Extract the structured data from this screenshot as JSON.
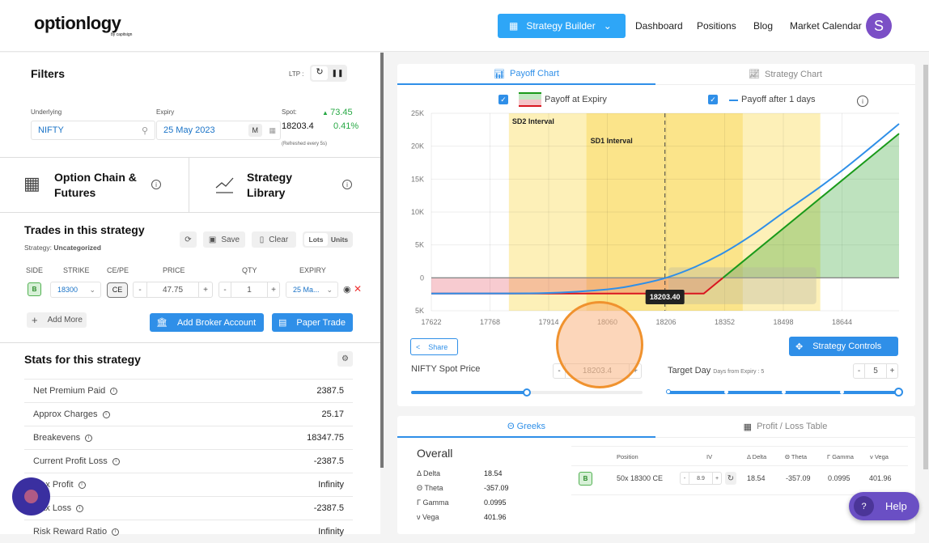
{
  "header": {
    "logo": "optionlogy",
    "logo_sub": "by capitsign",
    "strategy_builder": "Strategy Builder",
    "nav": [
      "Dashboard",
      "Positions",
      "Blog",
      "Market Calendar"
    ],
    "avatar": "S"
  },
  "filters": {
    "title": "Filters",
    "ltp_label": "LTP :",
    "underlying_label": "Underlying",
    "underlying_value": "NIFTY",
    "expiry_label": "Expiry",
    "expiry_value": "25 May 2023",
    "expiry_mode": "M",
    "spot_label": "Spot:",
    "spot_value": "18203.4",
    "change": "73.45",
    "change_pct": "0.41%",
    "refresh_note": "(Refreshed every 5s)"
  },
  "links": {
    "option_chain": "Option Chain &",
    "option_chain2": "Futures",
    "strategy_library": "Strategy",
    "strategy_library2": "Library"
  },
  "trades": {
    "title": "Trades in this strategy",
    "strategy_label": "Strategy:",
    "strategy_value": "Uncategorized",
    "save": "Save",
    "clear": "Clear",
    "lots": "Lots",
    "units": "Units",
    "columns": [
      "SIDE",
      "STRIKE",
      "CE/PE",
      "PRICE",
      "QTY",
      "EXPIRY"
    ],
    "row": {
      "side": "B",
      "strike": "18300",
      "type": "CE",
      "price": "47.75",
      "qty": "1",
      "expiry": "25 Ma..."
    },
    "add_more": "Add More",
    "add_broker": "Add Broker Account",
    "paper_trade": "Paper Trade"
  },
  "stats": {
    "title": "Stats for this strategy",
    "rows": [
      {
        "label": "Net Premium Paid",
        "value": "2387.5"
      },
      {
        "label": "Approx Charges",
        "value": "25.17"
      },
      {
        "label": "Breakevens",
        "value": "18347.75"
      },
      {
        "label": "Current Profit Loss",
        "value": "-2387.5"
      },
      {
        "label": "Max Profit",
        "value": "Infinity"
      },
      {
        "label": "Max Loss",
        "value": "-2387.5"
      },
      {
        "label": "Risk Reward Ratio",
        "value": "Infinity"
      }
    ]
  },
  "chart_tabs": {
    "payoff": "Payoff Chart",
    "strategy": "Strategy Chart"
  },
  "legend": {
    "expiry": "Payoff at Expiry",
    "after": "Payoff after 1 days"
  },
  "chart_data": {
    "type": "line",
    "x_ticks": [
      "17622",
      "17768",
      "17914",
      "18060",
      "18206",
      "18352",
      "18498",
      "18644"
    ],
    "y_ticks": [
      "25K",
      "20K",
      "15K",
      "10K",
      "5K",
      "0",
      "5K"
    ],
    "xlim": [
      17622,
      18786
    ],
    "ylim": [
      -5000,
      25000
    ],
    "bands": [
      {
        "label": "SD2 Interval",
        "range": [
          17815,
          18590
        ]
      },
      {
        "label": "SD1 Interval",
        "range": [
          18008,
          18397
        ]
      }
    ],
    "spot_marker": {
      "x": 18203.4,
      "label": "18203.40"
    },
    "series": [
      {
        "name": "Payoff at Expiry",
        "points": [
          [
            17622,
            -2387.5
          ],
          [
            18300,
            -2387.5
          ],
          [
            18347.75,
            0
          ],
          [
            18786,
            21912.5
          ]
        ]
      },
      {
        "name": "Payoff after 1 days",
        "points": [
          [
            17622,
            -2380
          ],
          [
            17768,
            -2370
          ],
          [
            17914,
            -2300
          ],
          [
            18060,
            -1750
          ],
          [
            18130,
            -1100
          ],
          [
            18206,
            0
          ],
          [
            18280,
            1700
          ],
          [
            18352,
            3900
          ],
          [
            18425,
            6700
          ],
          [
            18498,
            9900
          ],
          [
            18571,
            13000
          ],
          [
            18644,
            16300
          ],
          [
            18715,
            19800
          ],
          [
            18786,
            23400
          ]
        ]
      }
    ],
    "colors": {
      "profit": "#1a9a1a",
      "loss": "#d9161f",
      "after": "#2f8fe8",
      "sd2": "#fdf0b8",
      "sd1": "#fbe48a"
    }
  },
  "controls": {
    "share": "Share",
    "strategy_controls": "Strategy Controls",
    "spot_label": "NIFTY Spot Price",
    "spot_value": "18203.4",
    "spot_slider": 0.5,
    "target_label": "Target Day",
    "target_sub": "Days from Expiry : 5",
    "target_value": "5",
    "target_slider": 1.0
  },
  "greeks": {
    "tab": "Θ Greeks",
    "pl_tab": "Profit / Loss Table",
    "overall": "Overall",
    "overall_rows": [
      {
        "label": "Δ Delta",
        "value": "18.54"
      },
      {
        "label": "Θ Theta",
        "value": "-357.09"
      },
      {
        "label": "Γ Gamma",
        "value": "0.0995"
      },
      {
        "label": "ν Vega",
        "value": "401.96"
      }
    ],
    "columns": [
      "Position",
      "IV",
      "Δ Delta",
      "Θ Theta",
      "Γ Gamma",
      "ν Vega"
    ],
    "row": {
      "side": "B",
      "position": "50x 18300 CE",
      "iv": "8.9",
      "delta": "18.54",
      "theta": "-357.09",
      "gamma": "0.0995",
      "vega": "401.96"
    }
  },
  "help": "Help"
}
